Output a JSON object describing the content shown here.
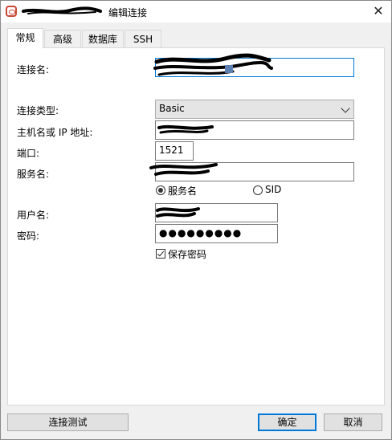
{
  "window": {
    "title": "编辑连接",
    "close_glyph": "✕",
    "icon": "oracle-db-icon"
  },
  "tabs": [
    {
      "label": "常规",
      "active": true
    },
    {
      "label": "高级",
      "active": false
    },
    {
      "label": "数据库",
      "active": false
    },
    {
      "label": "SSH",
      "active": false
    }
  ],
  "form": {
    "connection_name_label": "连接名:",
    "connection_type_label": "连接类型:",
    "connection_type_value": "Basic",
    "host_label": "主机名或 IP 地址:",
    "port_label": "端口:",
    "port_value": "1521",
    "service_name_label": "服务名:",
    "radio_service_label": "服务名",
    "radio_sid_label": "SID",
    "radio_selected": "服务名",
    "username_label": "用户名:",
    "password_label": "密码:",
    "password_mask": "●●●●●●●●●",
    "save_password_label": "保存密码",
    "save_password_checked": true
  },
  "buttons": {
    "test_connection": "连接测试",
    "ok": "确定",
    "cancel": "取消"
  },
  "colors": {
    "accent": "#0078d7",
    "oracle_red": "#c74634",
    "redaction_black": "#000000"
  }
}
